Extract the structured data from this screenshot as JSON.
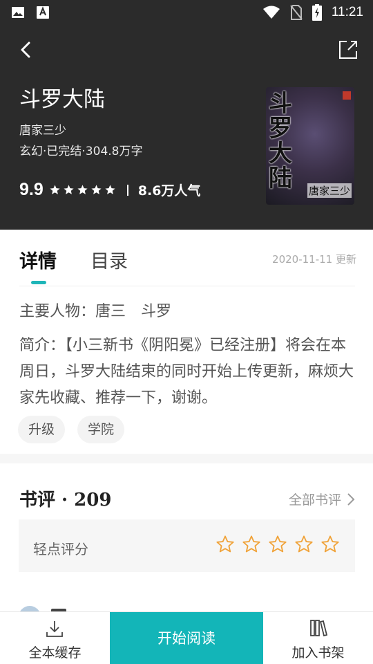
{
  "status_bar": {
    "time": "11:21",
    "icons": [
      "image-icon",
      "text-a-icon",
      "wifi-icon",
      "no-sim-icon",
      "battery-charging-icon"
    ]
  },
  "nav": {
    "back_icon": "chevron-left-icon",
    "share_icon": "share-out-icon"
  },
  "book": {
    "title": "斗罗大陆",
    "author": "唐家三少",
    "meta": "玄幻·已完结·304.8万字",
    "rating": "9.9",
    "stars": 5,
    "popularity": "8.6万人气",
    "cover": {
      "title": "斗罗大陆",
      "author": "唐家三少"
    }
  },
  "tabs": {
    "detail": "详情",
    "toc": "目录",
    "updated": "2020-11-11 更新"
  },
  "detail": {
    "characters": "主要人物：唐三　斗罗",
    "intro": "简介：【小三新书《阴阳冕》已经注册】将会在本周日，斗罗大陆结束的同时开始上传更新，麻烦大家先收藏、推荐一下，谢谢。",
    "tags": [
      "升级",
      "学院"
    ]
  },
  "reviews": {
    "title": "书评 · 209",
    "all_link": "全部书评",
    "rate_prompt": "轻点评分",
    "rate_stars": 5
  },
  "bottom_bar": {
    "download": "全本缓存",
    "read": "开始阅读",
    "shelf": "加入书架"
  },
  "colors": {
    "accent": "#13b5b8",
    "star_outline": "#f0a33a",
    "header_bg": "#2b2b2b"
  }
}
